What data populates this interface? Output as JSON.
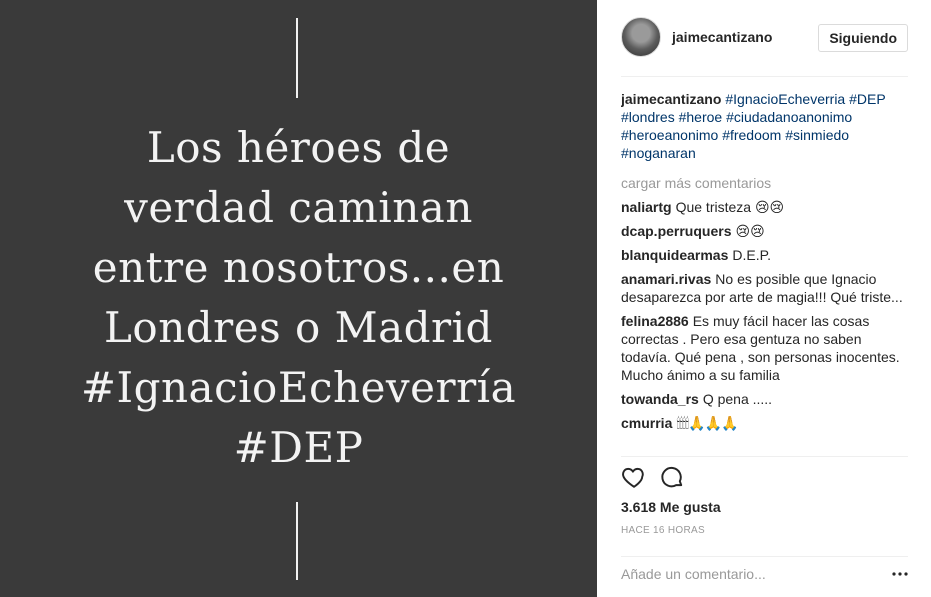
{
  "image": {
    "quote_lines": [
      "Los héroes de",
      "verdad caminan",
      "entre nosotros...en",
      "Londres o Madrid",
      "#IgnacioEcheverría",
      "#DEP"
    ]
  },
  "header": {
    "username": "jaimecantizano",
    "follow_label": "Siguiendo"
  },
  "caption": {
    "user": "jaimecantizano",
    "tags": [
      "#IgnacioEcheverria",
      "#DEP",
      "#londres",
      "#heroe",
      "#ciudadanoanonimo",
      "#heroeanonimo",
      "#fredoom",
      "#sinmiedo",
      "#noganaran"
    ]
  },
  "load_more": "cargar más comentarios",
  "comments": [
    {
      "user": "naliartg",
      "text": "Que tristeza 😢😢"
    },
    {
      "user": "dcap.perruquers",
      "text": "😢😢"
    },
    {
      "user": "blanquidearmas",
      "text": "D.E.P."
    },
    {
      "user": "anamari.rivas",
      "text": "No es posible que Ignacio desaparezca por arte de magia!!! Qué triste..."
    },
    {
      "user": "felina2886",
      "text": "Es muy fácil hacer las cosas correctas . Pero esa gentuza no saben todavía. Qué pena , son personas inocentes. Mucho ánimo a su familia"
    },
    {
      "user": "towanda_rs",
      "text": "Q pena ....."
    },
    {
      "user": "cmurria",
      "text": "🕯🕯🕯🕯🙏🙏🙏"
    }
  ],
  "likes": "3.618 Me gusta",
  "time_ago": "HACE 16 HORAS",
  "add_comment": {
    "placeholder": "Añade un comentario..."
  },
  "icons": {
    "like": "heart-icon",
    "comment": "comment-bubble-icon",
    "more": "more-options-icon"
  }
}
